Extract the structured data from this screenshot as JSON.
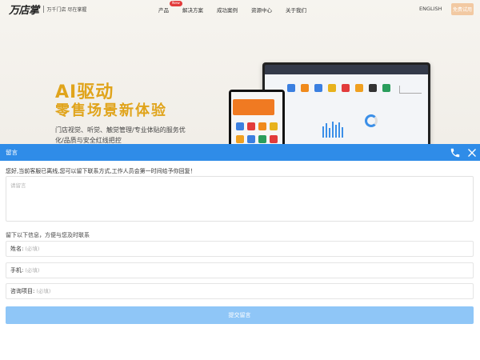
{
  "nav": {
    "logo_main": "万店掌",
    "logo_tagline": "万千门店 尽在掌握",
    "items": [
      {
        "label": "产品",
        "badge": "New"
      },
      {
        "label": "解决方案"
      },
      {
        "label": "成功案例"
      },
      {
        "label": "资源中心"
      },
      {
        "label": "关于我们"
      }
    ],
    "language": "ENGLISH",
    "cta": "免费试用"
  },
  "hero": {
    "title_line1": "AI驱动",
    "title_line2": "零售场景新体验",
    "desc_line1": "门店视觉、听觉、触觉管理/专业体贴的服务优",
    "desc_line2": "化/品质与安全红线把控",
    "accent_color": "#e0a41b"
  },
  "dialog": {
    "title": "留言",
    "header_color": "#2f8ce8",
    "icons": [
      "phone-icon",
      "close-icon"
    ],
    "notice": "您好,当前客服已离线,您可以留下联系方式,工作人员会第一时间给予你回复！",
    "message_placeholder": "请留言",
    "contact_hint": "留下以下信息，方便与您及时联系",
    "fields": [
      {
        "label": "姓名:",
        "placeholder": "(必填)"
      },
      {
        "label": "手机:",
        "placeholder": "(必填)"
      },
      {
        "label": "咨询项目:",
        "placeholder": "(必填)"
      }
    ],
    "submit_label": "提交留言",
    "submit_color": "#8fc6f7"
  }
}
